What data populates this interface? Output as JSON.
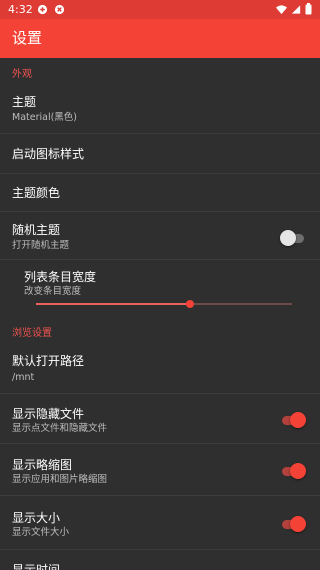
{
  "status_bar": {
    "time": "4:32",
    "icons": [
      "android-system-icon",
      "android-system-icon",
      "wifi-icon",
      "signal-icon",
      "battery-icon"
    ]
  },
  "app_bar": {
    "title": "设置"
  },
  "colors": {
    "accent": "#f44336",
    "status_bar": "#dd3b34",
    "background": "#2f2f2f"
  },
  "sections": {
    "appearance": {
      "header": "外观",
      "theme": {
        "title": "主题",
        "summary": "Material(黑色)"
      },
      "launcher_icon": {
        "title": "启动图标样式"
      },
      "theme_color": {
        "title": "主题颜色"
      },
      "random_theme": {
        "title": "随机主题",
        "summary": "打开随机主题",
        "enabled": false
      },
      "list_item_width": {
        "title": "列表条目宽度",
        "summary": "改变条目宽度",
        "value_fraction": 0.6
      }
    },
    "browse": {
      "header": "浏览设置",
      "default_path": {
        "title": "默认打开路径",
        "summary": "/mnt"
      },
      "show_hidden": {
        "title": "显示隐藏文件",
        "summary": "显示点文件和隐藏文件",
        "enabled": true
      },
      "show_thumbnails": {
        "title": "显示略缩图",
        "summary": "显示应用和图片略缩图",
        "enabled": true
      },
      "show_size": {
        "title": "显示大小",
        "summary": "显示文件大小",
        "enabled": true
      },
      "show_time": {
        "title": "显示时间"
      }
    }
  }
}
